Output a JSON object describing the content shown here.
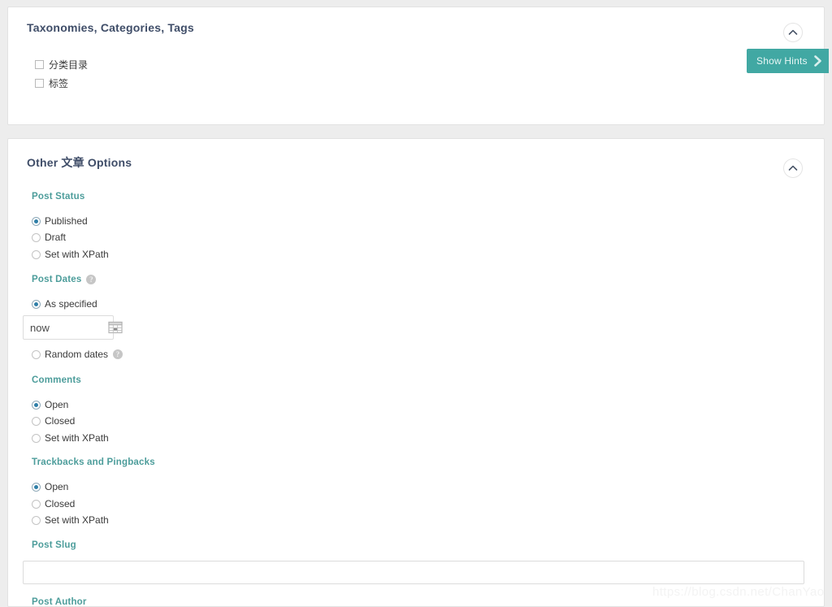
{
  "page": {
    "background_color": "#ededed",
    "watermark": "https://blog.csdn.net/ChanYao"
  },
  "colors": {
    "panel_title": "#3f4d68",
    "section_label_teal": "#4d9d9b",
    "accent_teal": "#41a8a3",
    "radio_dot": "#2f7fa8",
    "panel_bg": "#ffffff",
    "border": "#e2e2e2"
  },
  "show_hints_button": {
    "label": "Show Hints",
    "icon": "chevron-right-icon"
  },
  "panels": [
    {
      "id": "taxonomies",
      "title": "Taxonomies, Categories, Tags",
      "collapse_icon": "chevron-up-icon",
      "checkboxes": [
        {
          "label": "分类目录",
          "checked": false
        },
        {
          "label": "标签",
          "checked": false
        }
      ]
    },
    {
      "id": "other-post-options",
      "title": "Other 文章 Options",
      "collapse_icon": "chevron-up-icon",
      "sections": [
        {
          "id": "post-status",
          "label": "Post Status",
          "help": false,
          "options": [
            {
              "label": "Published",
              "checked": true
            },
            {
              "label": "Draft",
              "checked": false
            },
            {
              "label": "Set with XPath",
              "checked": false
            }
          ]
        },
        {
          "id": "post-dates",
          "label": "Post Dates",
          "help": true,
          "help_glyph": "?",
          "options": [
            {
              "label": "As specified",
              "checked": true
            },
            {
              "label": "Random dates",
              "checked": false,
              "help": true,
              "help_glyph": "?"
            }
          ],
          "date_input": {
            "value": "now",
            "placeholder": "now",
            "calendar_icon": "calendar-icon"
          }
        },
        {
          "id": "comments",
          "label": "Comments",
          "help": false,
          "options": [
            {
              "label": "Open",
              "checked": true
            },
            {
              "label": "Closed",
              "checked": false
            },
            {
              "label": "Set with XPath",
              "checked": false
            }
          ]
        },
        {
          "id": "trackbacks-pingbacks",
          "label": "Trackbacks and Pingbacks",
          "help": false,
          "options": [
            {
              "label": "Open",
              "checked": true
            },
            {
              "label": "Closed",
              "checked": false
            },
            {
              "label": "Set with XPath",
              "checked": false
            }
          ]
        },
        {
          "id": "post-slug",
          "label": "Post Slug",
          "help": false,
          "slug_input": {
            "value": "",
            "placeholder": ""
          }
        },
        {
          "id": "post-author",
          "label": "Post Author",
          "help": false
        }
      ]
    }
  ]
}
